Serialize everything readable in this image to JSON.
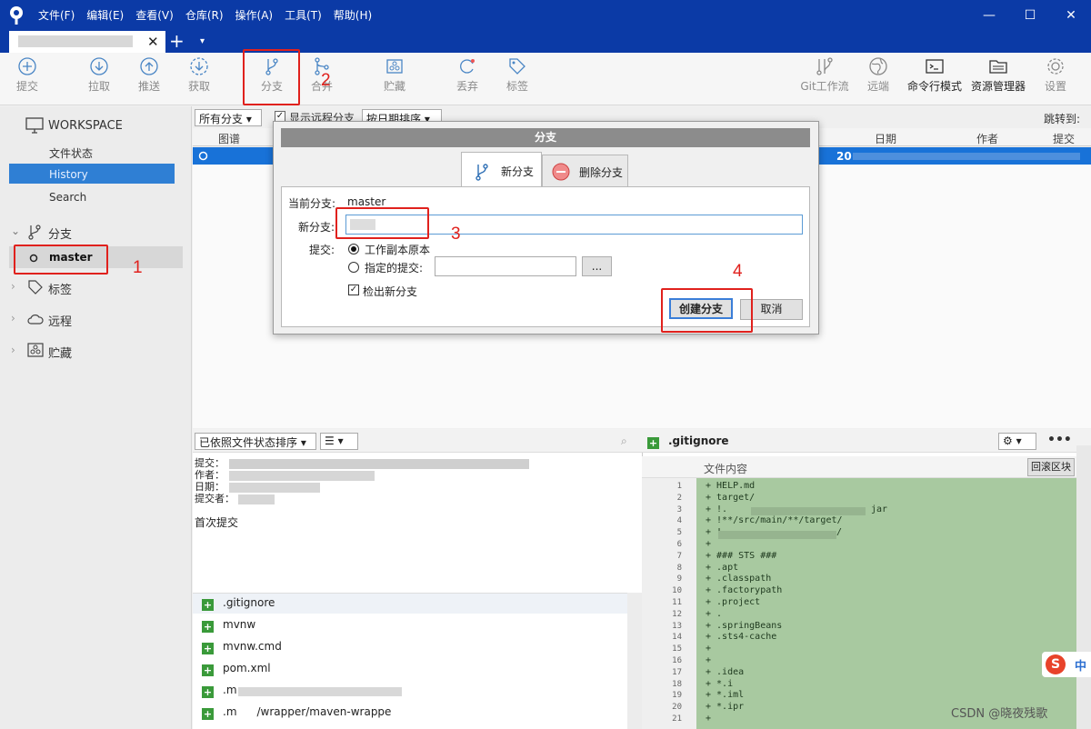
{
  "menu": [
    "文件(F)",
    "编辑(E)",
    "查看(V)",
    "仓库(R)",
    "操作(A)",
    "工具(T)",
    "帮助(H)"
  ],
  "window_controls": {
    "minimize": "—",
    "maximize": "☐",
    "close": "✕"
  },
  "tab": {
    "close": "✕",
    "plus": "+",
    "dropdown": "▾"
  },
  "toolbar": {
    "commit": "提交",
    "pull": "拉取",
    "push": "推送",
    "fetch": "获取",
    "branch": "分支",
    "merge": "合并",
    "stash": "贮藏",
    "discard": "丢弃",
    "tag": "标签",
    "gitflow": "Git工作流",
    "remote": "远端",
    "terminal": "命令行模式",
    "explorer": "资源管理器",
    "settings": "设置"
  },
  "sidebar": {
    "workspace": "WORKSPACE",
    "file_status": "文件状态",
    "history": "History",
    "search": "Search",
    "branches": "分支",
    "master": "master",
    "tags": "标签",
    "remotes": "远程",
    "stashes": "贮藏"
  },
  "filter": {
    "all_branches": "所有分支",
    "show_remote": "显示远程分支",
    "sort_by_date": "按日期排序",
    "jump_to": "跳转到:"
  },
  "grid_headers": {
    "graph": "图谱",
    "date": "日期",
    "author": "作者",
    "commit": "提交"
  },
  "selected_row_date_prefix": "20",
  "lower_left": {
    "sort_combo": "已依照文件状态排序",
    "labels": [
      "提交：",
      "作者：",
      "日期：",
      "提交者："
    ],
    "message": "首次提交",
    "files": [
      ".gitignore",
      "mvnw",
      "mvnw.cmd",
      "pom.xml",
      ".m",
      ".m"
    ],
    "partial_text": "/wrapper/maven-wrappe"
  },
  "lower_right": {
    "file_title": ".gitignore",
    "content_header": "文件内容",
    "revert_hunk": "回滚区块",
    "line_numbers": [
      "1",
      "2",
      "3",
      "4",
      "5",
      "6",
      "7",
      "8",
      "9",
      "10",
      "11",
      "12",
      "13",
      "14",
      "15",
      "16",
      "17",
      "18",
      "19",
      "20",
      "21"
    ],
    "lines": [
      "+ HELP.md",
      "+ target/",
      "+ !.",
      "+ !**/src/main/**/target/",
      "+ !",
      "+",
      "+ ### STS ###",
      "+ .apt",
      "+ .classpath",
      "+ .factorypath",
      "+ .project",
      "+ .",
      "+ .springBeans",
      "+ .sts4-cache",
      "+",
      "+",
      "+ .idea",
      "+ *.i",
      "+ *.iml",
      "+ *.ipr",
      "+"
    ],
    "line3_suffix": "jar",
    "line5_suffix": "/"
  },
  "dialog": {
    "title": "分支",
    "tab_new": "新分支",
    "tab_delete": "删除分支",
    "current_branch_label": "当前分支:",
    "current_branch_value": "master",
    "new_branch_label": "新分支:",
    "commit_label": "提交:",
    "radio_working_copy": "工作副本原本",
    "radio_specified": "指定的提交:",
    "browse": "...",
    "checkout_new": "检出新分支",
    "create_button": "创建分支",
    "cancel_button": "取消"
  },
  "annotations": [
    "1",
    "2",
    "3",
    "4"
  ],
  "ime": "中",
  "watermark": "CSDN @晓夜残歌",
  "colors": {
    "titlebar": "#0b3aa6",
    "selection": "#2f7fd4",
    "annotation_red": "#e0211d",
    "diff_bg": "#a8c9a0"
  }
}
